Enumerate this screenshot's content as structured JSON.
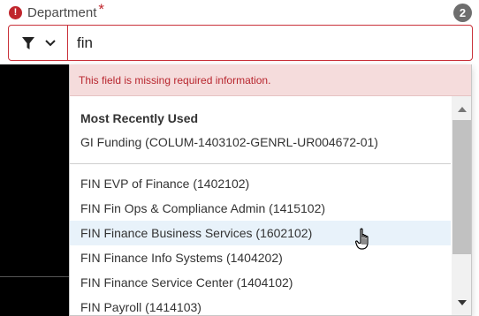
{
  "field": {
    "label": "Department",
    "required_mark": "*",
    "error_glyph": "!",
    "count": "2"
  },
  "search": {
    "value": "fin",
    "filter_icon": "filter-icon",
    "dropdown_icon": "chevron-down-icon"
  },
  "dropdown": {
    "error_message": "This field is missing required information.",
    "mru_heading": "Most Recently Used",
    "mru_items": [
      {
        "label": "GI Funding (COLUM-1403102-GENRL-UR004672-01)"
      }
    ],
    "options": [
      {
        "label": "FIN EVP of Finance (1402102)"
      },
      {
        "label": "FIN Fin Ops & Compliance Admin (1415102)"
      },
      {
        "label": "FIN Finance Business Services (1602102)",
        "highlighted": true
      },
      {
        "label": "FIN Finance Info Systems (1404202)"
      },
      {
        "label": "FIN Finance Service Center (1404102)"
      },
      {
        "label": "FIN Payroll (1414103)"
      }
    ]
  },
  "colors": {
    "error": "#c0262d",
    "error_bg": "#f5dcdc",
    "highlight": "#e8f2fa",
    "badge": "#6e6e6e"
  }
}
